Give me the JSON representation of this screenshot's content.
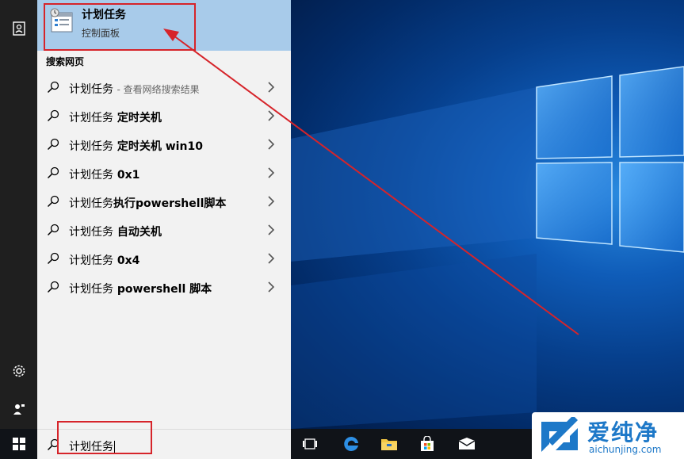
{
  "best_match": {
    "title": "计划任务",
    "subtitle": "控制面板"
  },
  "web_section_label": "搜索网页",
  "results": [
    {
      "prefix": "计划任务",
      "suffix": "",
      "hint": "- 查看网络搜索结果"
    },
    {
      "prefix": "计划任务",
      "suffix": " 定时关机",
      "hint": ""
    },
    {
      "prefix": "计划任务",
      "suffix": " 定时关机 win10",
      "hint": ""
    },
    {
      "prefix": "计划任务",
      "suffix": " 0x1",
      "hint": ""
    },
    {
      "prefix": "计划任务",
      "suffix": "执行powershell脚本",
      "hint": ""
    },
    {
      "prefix": "计划任务",
      "suffix": " 自动关机",
      "hint": ""
    },
    {
      "prefix": "计划任务",
      "suffix": " 0x4",
      "hint": ""
    },
    {
      "prefix": "计划任务",
      "suffix": " powershell 脚本",
      "hint": ""
    }
  ],
  "search": {
    "query": "计划任务"
  },
  "watermark": {
    "brand": "爱纯净",
    "site": "aichunjing.com"
  },
  "colors": {
    "highlight_red": "#d6242a",
    "best_match_bg": "#a8cbea",
    "panel_bg": "#f2f2f2",
    "taskbar_bg": "#101318"
  }
}
